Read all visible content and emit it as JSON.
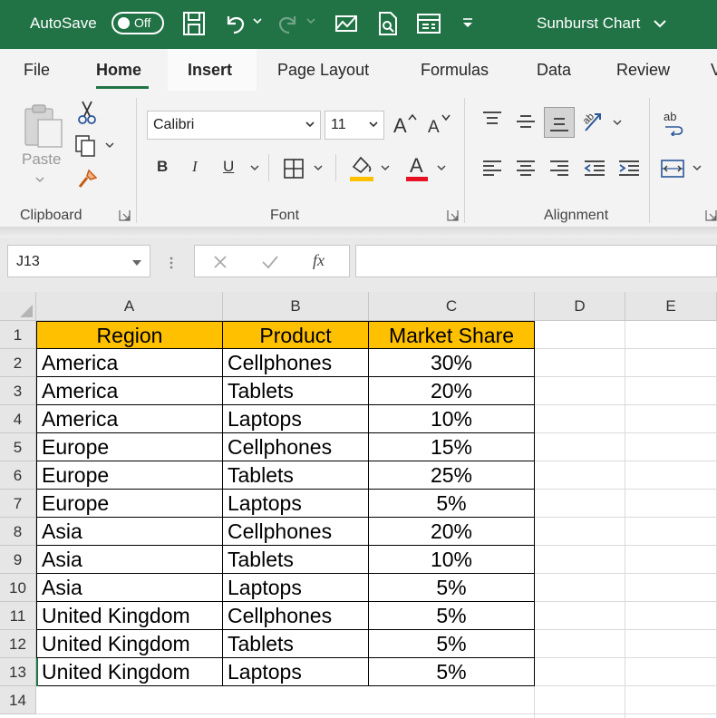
{
  "titlebar": {
    "autosave_label": "AutoSave",
    "autosave_state": "Off",
    "doc_title": "Sunburst Chart",
    "icons": [
      "save-icon",
      "undo-icon",
      "redo-icon",
      "touch-mode-icon",
      "print-preview-icon",
      "form-icon",
      "customize-qat-icon"
    ]
  },
  "ribbon_tabs": [
    "File",
    "Home",
    "Insert",
    "Page Layout",
    "Formulas",
    "Data",
    "Review",
    "V"
  ],
  "active_tab": "Home",
  "ribbon": {
    "clipboard": {
      "label": "Clipboard",
      "paste_label": "Paste"
    },
    "font": {
      "label": "Font",
      "font_name": "Calibri",
      "font_size": "11",
      "bold": "B",
      "italic": "I",
      "underline": "U",
      "font_color_glyph": "A"
    },
    "alignment": {
      "label": "Alignment"
    }
  },
  "formula_bar": {
    "name_box": "J13",
    "formula": "",
    "fx_label": "fx"
  },
  "sheet": {
    "columns": [
      "A",
      "B",
      "C",
      "D",
      "E"
    ],
    "rows": [
      "1",
      "2",
      "3",
      "4",
      "5",
      "6",
      "7",
      "8",
      "9",
      "10",
      "11",
      "12",
      "13",
      "14"
    ],
    "table": {
      "headers": [
        "Region",
        "Product",
        "Market Share"
      ],
      "data": [
        [
          "America",
          "Cellphones",
          "30%"
        ],
        [
          "America",
          "Tablets",
          "20%"
        ],
        [
          "America",
          "Laptops",
          "10%"
        ],
        [
          "Europe",
          "Cellphones",
          "15%"
        ],
        [
          "Europe",
          "Tablets",
          "25%"
        ],
        [
          "Europe",
          "Laptops",
          "5%"
        ],
        [
          "Asia",
          "Cellphones",
          "20%"
        ],
        [
          "Asia",
          "Tablets",
          "10%"
        ],
        [
          "Asia",
          "Laptops",
          "5%"
        ],
        [
          "United Kingdom",
          "Cellphones",
          "5%"
        ],
        [
          "United Kingdom",
          "Tablets",
          "5%"
        ],
        [
          "United Kingdom",
          "Laptops",
          "5%"
        ]
      ]
    }
  },
  "colors": {
    "title_bar": "#217346",
    "header_fill": "#ffc000",
    "highlight_bar": "#ffc000",
    "font_color_bar": "#e81123"
  }
}
